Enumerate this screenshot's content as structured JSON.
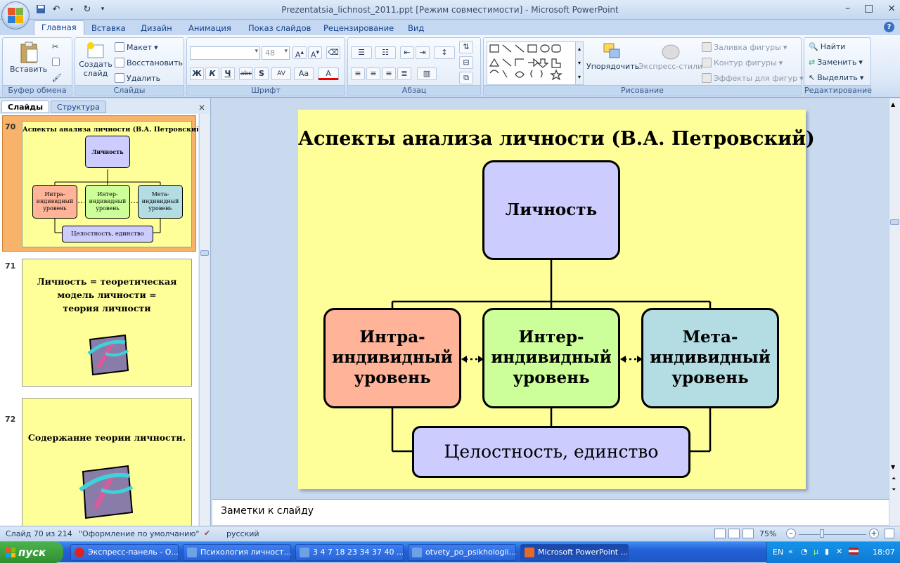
{
  "window": {
    "title": "Prezentatsia_lichnost_2011.ppt [Режим совместимости] - Microsoft PowerPoint",
    "controls": [
      "–",
      "□",
      "×"
    ]
  },
  "tabs": [
    "Главная",
    "Вставка",
    "Дизайн",
    "Анимация",
    "Показ слайдов",
    "Рецензирование",
    "Вид"
  ],
  "ribbon": {
    "clipboard": {
      "paste": "Вставить",
      "label": "Буфер обмена"
    },
    "slides": {
      "new_slide": "Создать слайд",
      "layout": "Макет",
      "reset": "Восстановить",
      "delete": "Удалить",
      "label": "Слайды"
    },
    "font": {
      "size": "48",
      "label": "Шрифт",
      "buttons": [
        "Ж",
        "К",
        "Ч",
        "abc",
        "S",
        "AV",
        "Aa",
        "A"
      ]
    },
    "paragraph": {
      "label": "Абзац"
    },
    "drawing": {
      "arrange": "Упорядочить",
      "quick_styles": "Экспресс-стили",
      "fill": "Заливка фигуры",
      "outline": "Контур фигуры",
      "effects": "Эффекты для фигур",
      "label": "Рисование"
    },
    "editing": {
      "find": "Найти",
      "replace": "Заменить",
      "select": "Выделить",
      "label": "Редактирование"
    }
  },
  "left_panel": {
    "tabs": [
      "Слайды",
      "Структура"
    ],
    "close": "×",
    "thumbs": [
      {
        "num": "70",
        "title": "Аспекты анализа личности (В.А. Петровский)",
        "top": "Личность",
        "boxes": [
          "Интра-индивидный уровень",
          "Интер-индивидный уровень",
          "Мета-индивидный уровень"
        ],
        "bottom": "Целостность, единство"
      },
      {
        "num": "71",
        "lines": [
          "Личность = теоретическая",
          "модель личности =",
          "теория личности"
        ]
      },
      {
        "num": "72",
        "lines": [
          "Содержание теории личности."
        ]
      }
    ]
  },
  "slide": {
    "title": "Аспекты анализа личности (В.А. Петровский)",
    "top_box": "Личность",
    "intra": [
      "Интра-",
      "индивидный",
      "уровень"
    ],
    "inter": [
      "Интер-",
      "индивидный",
      "уровень"
    ],
    "meta": [
      "Мета-",
      "индивидный",
      "уровень"
    ],
    "bottom_box": "Целостность, единство",
    "colors": {
      "background": "#ffff99",
      "top": "#ccccff",
      "intra": "#ffb399",
      "inter": "#ccff99",
      "meta": "#b3dde3",
      "bottom": "#ccccff"
    }
  },
  "notes": {
    "placeholder": "Заметки к слайду"
  },
  "status": {
    "slide": "Слайд 70 из 214",
    "theme": "\"Оформление по умолчанию\"",
    "language": "русский",
    "zoom": "75%"
  },
  "taskbar": {
    "start": "пуск",
    "items": [
      "Экспресс-панель - О...",
      "Психология личност...",
      "3 4 7 18 23 34 37 40 ...",
      "otvety_po_psikhologii...",
      "Microsoft PowerPoint ..."
    ],
    "lang": "EN",
    "time": "18:07"
  }
}
